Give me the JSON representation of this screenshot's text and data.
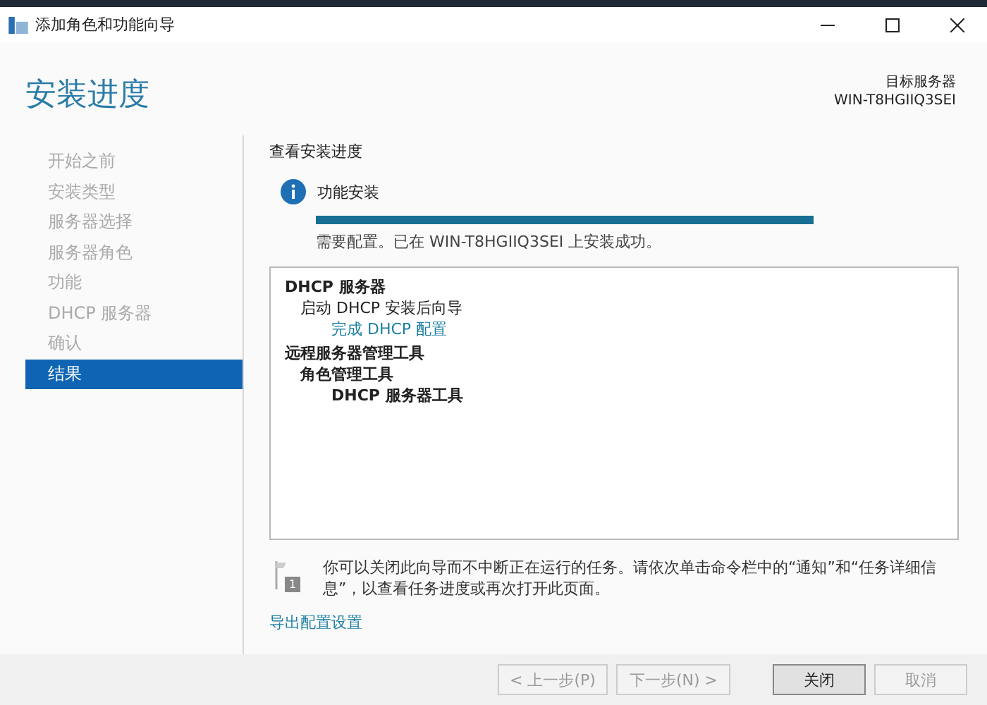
{
  "window": {
    "title": "添加角色和功能向导"
  },
  "header": {
    "title": "安装进度",
    "target_label": "目标服务器",
    "target_server": "WIN-T8HGIIQ3SEI"
  },
  "sidebar": {
    "items": [
      {
        "label": "开始之前",
        "selected": false
      },
      {
        "label": "安装类型",
        "selected": false
      },
      {
        "label": "服务器选择",
        "selected": false
      },
      {
        "label": "服务器角色",
        "selected": false
      },
      {
        "label": "功能",
        "selected": false
      },
      {
        "label": "DHCP 服务器",
        "selected": false
      },
      {
        "label": "确认",
        "selected": false
      },
      {
        "label": "结果",
        "selected": true
      }
    ]
  },
  "content": {
    "heading": "查看安装进度",
    "status": {
      "title": "功能安装",
      "level": 1,
      "message": "需要配置。已在 WIN-T8HGIIQ3SEI 上安装成功。"
    },
    "results": [
      {
        "kind": "heading",
        "text": "DHCP 服务器",
        "children": [
          {
            "kind": "text",
            "text": "启动 DHCP 安装后向导",
            "children": [
              {
                "kind": "link",
                "text": "完成 DHCP 配置"
              }
            ]
          }
        ]
      },
      {
        "kind": "heading",
        "text": "远程服务器管理工具",
        "children": [
          {
            "kind": "heading",
            "text": "角色管理工具",
            "children": [
              {
                "kind": "heading",
                "text": "DHCP 服务器工具"
              }
            ]
          }
        ]
      }
    ],
    "notice": "你可以关闭此向导而不中断正在运行的任务。请依次单击命令栏中的“通知”和“任务详细信息”，以查看任务进度或再次打开此页面。",
    "notice_badge": "1",
    "export_link": "导出配置设置"
  },
  "buttons": [
    {
      "label": "< 上一步(P)",
      "disabled": true,
      "default": false
    },
    {
      "label": "下一步(N) >",
      "disabled": true,
      "default": false
    },
    {
      "label": "关闭",
      "disabled": false,
      "default": true
    },
    {
      "label": "取消",
      "disabled": true,
      "default": false
    }
  ]
}
